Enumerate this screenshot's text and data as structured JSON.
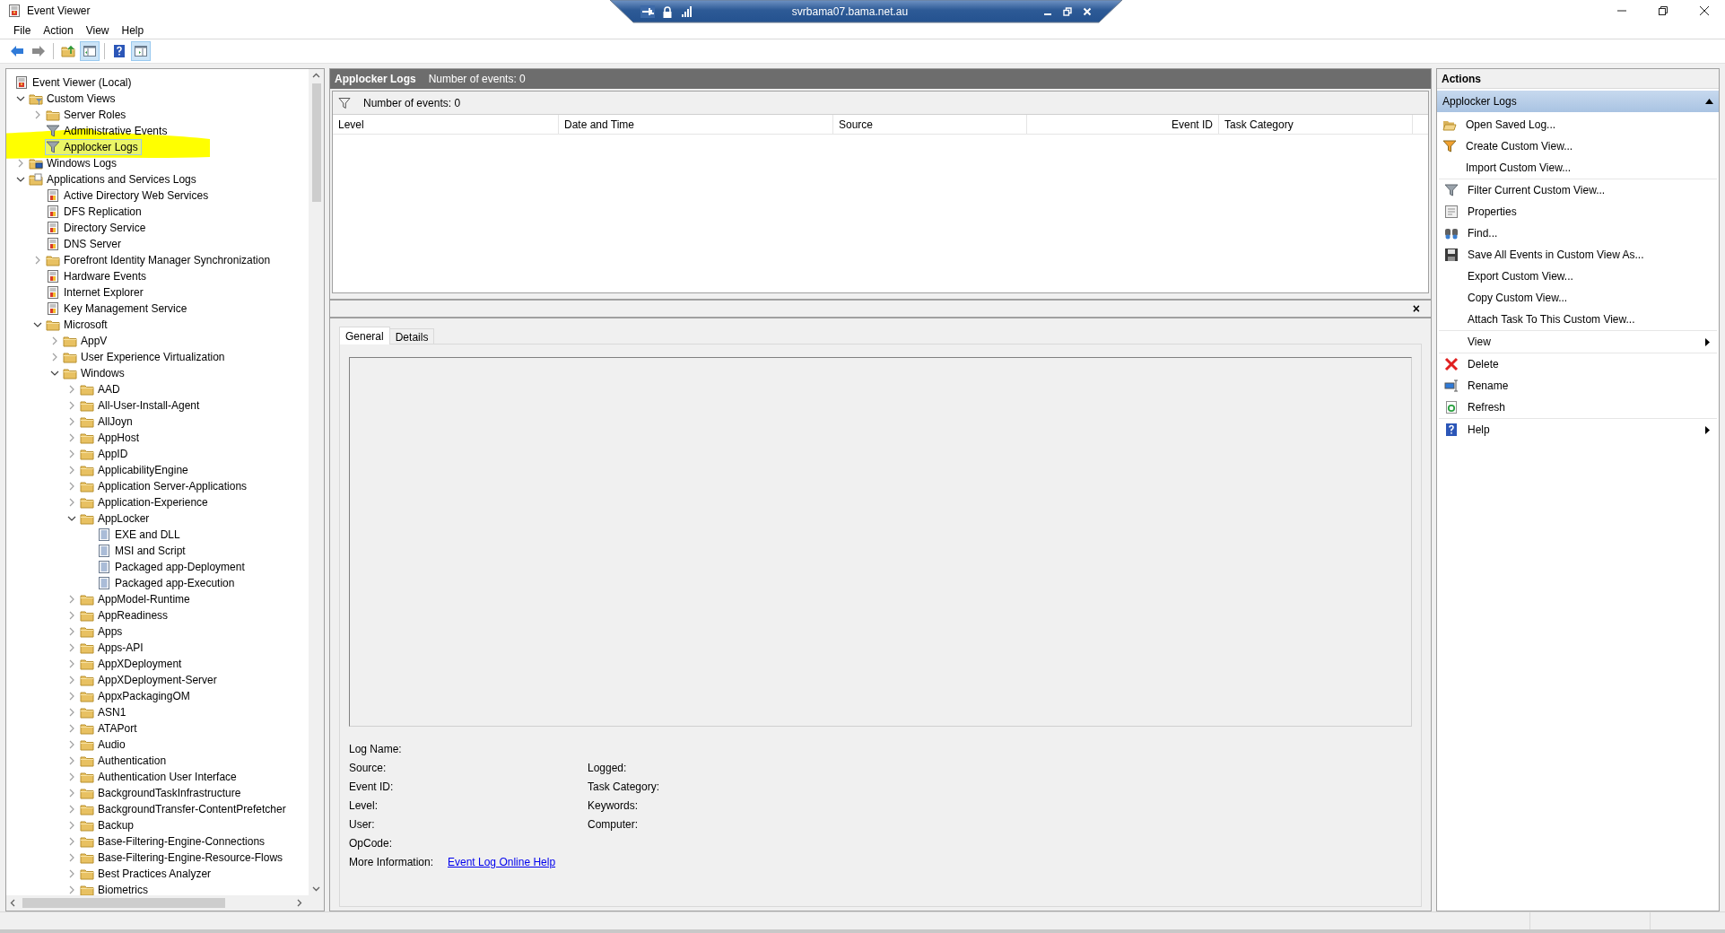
{
  "window": {
    "title": "Event Viewer"
  },
  "remote_bar": {
    "host": "svrbama07.bama.net.au"
  },
  "menu": [
    "File",
    "Action",
    "View",
    "Help"
  ],
  "toolbar": [
    {
      "kind": "back",
      "pressed": false,
      "disabled": false
    },
    {
      "kind": "forward",
      "pressed": false,
      "disabled": true
    },
    {
      "kind": "up",
      "pressed": false,
      "disabled": false
    },
    {
      "kind": "console-tree",
      "pressed": true,
      "disabled": false
    },
    {
      "kind": "help",
      "pressed": false,
      "disabled": false
    },
    {
      "kind": "action-pane",
      "pressed": true,
      "disabled": false
    }
  ],
  "tree": [
    {
      "label": "Event Viewer (Local)",
      "kind": "viewer",
      "selected": false,
      "highlighted": false,
      "children": [
        {
          "label": "Custom Views",
          "kind": "custom-folder",
          "expanded": true,
          "selected": false,
          "highlighted": false,
          "children": [
            {
              "label": "Server Roles",
              "kind": "folder",
              "expanded": false,
              "selected": false,
              "highlighted": false
            },
            {
              "label": "Administrative Events",
              "kind": "filter",
              "selected": false,
              "highlighted": false
            },
            {
              "label": "Applocker Logs",
              "kind": "filter",
              "selected": true,
              "highlighted": true
            }
          ]
        },
        {
          "label": "Windows Logs",
          "kind": "windows-folder",
          "expanded": false,
          "selected": false,
          "highlighted": false
        },
        {
          "label": "Applications and Services Logs",
          "kind": "apps-folder",
          "expanded": true,
          "selected": false,
          "highlighted": false,
          "children": [
            {
              "label": "Active Directory Web Services",
              "kind": "event-log",
              "selected": false,
              "highlighted": false
            },
            {
              "label": "DFS Replication",
              "kind": "event-log",
              "selected": false,
              "highlighted": false
            },
            {
              "label": "Directory Service",
              "kind": "event-log",
              "selected": false,
              "highlighted": false
            },
            {
              "label": "DNS Server",
              "kind": "event-log",
              "selected": false,
              "highlighted": false
            },
            {
              "label": "Forefront Identity Manager Synchronization",
              "kind": "folder",
              "expanded": false,
              "selected": false,
              "highlighted": false
            },
            {
              "label": "Hardware Events",
              "kind": "event-log",
              "selected": false,
              "highlighted": false
            },
            {
              "label": "Internet Explorer",
              "kind": "event-log",
              "selected": false,
              "highlighted": false
            },
            {
              "label": "Key Management Service",
              "kind": "event-log",
              "selected": false,
              "highlighted": false
            },
            {
              "label": "Microsoft",
              "kind": "folder",
              "expanded": true,
              "selected": false,
              "highlighted": false,
              "children": [
                {
                  "label": "AppV",
                  "kind": "folder",
                  "expanded": false,
                  "selected": false,
                  "highlighted": false
                },
                {
                  "label": "User Experience Virtualization",
                  "kind": "folder",
                  "expanded": false,
                  "selected": false,
                  "highlighted": false
                },
                {
                  "label": "Windows",
                  "kind": "folder",
                  "expanded": true,
                  "selected": false,
                  "highlighted": false,
                  "children": [
                    {
                      "label": "AAD",
                      "kind": "folder",
                      "expanded": false,
                      "selected": false,
                      "highlighted": false
                    },
                    {
                      "label": "All-User-Install-Agent",
                      "kind": "folder",
                      "expanded": false,
                      "selected": false,
                      "highlighted": false
                    },
                    {
                      "label": "AllJoyn",
                      "kind": "folder",
                      "expanded": false,
                      "selected": false,
                      "highlighted": false
                    },
                    {
                      "label": "AppHost",
                      "kind": "folder",
                      "expanded": false,
                      "selected": false,
                      "highlighted": false
                    },
                    {
                      "label": "AppID",
                      "kind": "folder",
                      "expanded": false,
                      "selected": false,
                      "highlighted": false
                    },
                    {
                      "label": "ApplicabilityEngine",
                      "kind": "folder",
                      "expanded": false,
                      "selected": false,
                      "highlighted": false
                    },
                    {
                      "label": "Application Server-Applications",
                      "kind": "folder",
                      "expanded": false,
                      "selected": false,
                      "highlighted": false
                    },
                    {
                      "label": "Application-Experience",
                      "kind": "folder",
                      "expanded": false,
                      "selected": false,
                      "highlighted": false
                    },
                    {
                      "label": "AppLocker",
                      "kind": "folder",
                      "expanded": true,
                      "selected": false,
                      "highlighted": false,
                      "children": [
                        {
                          "label": "EXE and DLL",
                          "kind": "plain-log",
                          "selected": false,
                          "highlighted": false
                        },
                        {
                          "label": "MSI and Script",
                          "kind": "plain-log",
                          "selected": false,
                          "highlighted": false
                        },
                        {
                          "label": "Packaged app-Deployment",
                          "kind": "plain-log",
                          "selected": false,
                          "highlighted": false
                        },
                        {
                          "label": "Packaged app-Execution",
                          "kind": "plain-log",
                          "selected": false,
                          "highlighted": false
                        }
                      ]
                    },
                    {
                      "label": "AppModel-Runtime",
                      "kind": "folder",
                      "expanded": false,
                      "selected": false,
                      "highlighted": false
                    },
                    {
                      "label": "AppReadiness",
                      "kind": "folder",
                      "expanded": false,
                      "selected": false,
                      "highlighted": false
                    },
                    {
                      "label": "Apps",
                      "kind": "folder",
                      "expanded": false,
                      "selected": false,
                      "highlighted": false
                    },
                    {
                      "label": "Apps-API",
                      "kind": "folder",
                      "expanded": false,
                      "selected": false,
                      "highlighted": false
                    },
                    {
                      "label": "AppXDeployment",
                      "kind": "folder",
                      "expanded": false,
                      "selected": false,
                      "highlighted": false
                    },
                    {
                      "label": "AppXDeployment-Server",
                      "kind": "folder",
                      "expanded": false,
                      "selected": false,
                      "highlighted": false
                    },
                    {
                      "label": "AppxPackagingOM",
                      "kind": "folder",
                      "expanded": false,
                      "selected": false,
                      "highlighted": false
                    },
                    {
                      "label": "ASN1",
                      "kind": "folder",
                      "expanded": false,
                      "selected": false,
                      "highlighted": false
                    },
                    {
                      "label": "ATAPort",
                      "kind": "folder",
                      "expanded": false,
                      "selected": false,
                      "highlighted": false
                    },
                    {
                      "label": "Audio",
                      "kind": "folder",
                      "expanded": false,
                      "selected": false,
                      "highlighted": false
                    },
                    {
                      "label": "Authentication",
                      "kind": "folder",
                      "expanded": false,
                      "selected": false,
                      "highlighted": false
                    },
                    {
                      "label": "Authentication User Interface",
                      "kind": "folder",
                      "expanded": false,
                      "selected": false,
                      "highlighted": false
                    },
                    {
                      "label": "BackgroundTaskInfrastructure",
                      "kind": "folder",
                      "expanded": false,
                      "selected": false,
                      "highlighted": false
                    },
                    {
                      "label": "BackgroundTransfer-ContentPrefetcher",
                      "kind": "folder",
                      "expanded": false,
                      "selected": false,
                      "highlighted": false
                    },
                    {
                      "label": "Backup",
                      "kind": "folder",
                      "expanded": false,
                      "selected": false,
                      "highlighted": false
                    },
                    {
                      "label": "Base-Filtering-Engine-Connections",
                      "kind": "folder",
                      "expanded": false,
                      "selected": false,
                      "highlighted": false
                    },
                    {
                      "label": "Base-Filtering-Engine-Resource-Flows",
                      "kind": "folder",
                      "expanded": false,
                      "selected": false,
                      "highlighted": false
                    },
                    {
                      "label": "Best Practices Analyzer",
                      "kind": "folder",
                      "expanded": false,
                      "selected": false,
                      "highlighted": false
                    },
                    {
                      "label": "Biometrics",
                      "kind": "folder",
                      "expanded": false,
                      "selected": false,
                      "highlighted": false
                    }
                  ]
                }
              ]
            }
          ]
        }
      ]
    }
  ],
  "events": {
    "title": "Applocker Logs",
    "count": "Number of events: 0",
    "filter_text": "Number of events: 0",
    "columns": [
      "Level",
      "Date and Time",
      "Source",
      "Event ID",
      "Task Category"
    ]
  },
  "preview": {
    "close": "×",
    "tabs": [
      {
        "label": "General",
        "selected": true
      },
      {
        "label": "Details",
        "selected": false
      }
    ],
    "rows": [
      [
        "Log Name:"
      ],
      [
        "Source:",
        "Logged:"
      ],
      [
        "Event ID:",
        "Task Category:"
      ],
      [
        "Level:",
        "Keywords:"
      ],
      [
        "User:",
        "Computer:"
      ],
      [
        "OpCode:"
      ]
    ],
    "more_info": {
      "label": "More Information:",
      "link": "Event Log Online Help"
    }
  },
  "actions": {
    "title": "Actions",
    "section": {
      "title": "Applocker Logs",
      "expanded": true
    },
    "groups": [
      [
        {
          "label": "Open Saved Log...",
          "kind": "open",
          "submenu": false
        },
        {
          "label": "Create Custom View...",
          "kind": "create-filter",
          "submenu": false
        },
        {
          "label": "Import Custom View...",
          "kind": "plain",
          "submenu": false
        }
      ],
      [
        {
          "label": "Filter Current Custom View...",
          "kind": "filter",
          "submenu": false
        },
        {
          "label": "Properties",
          "kind": "properties",
          "submenu": false
        },
        {
          "label": "Find...",
          "kind": "find",
          "submenu": false
        },
        {
          "label": "Save All Events in Custom View As...",
          "kind": "save",
          "submenu": false
        },
        {
          "label": "Export Custom View...",
          "kind": "plain",
          "submenu": false
        },
        {
          "label": "Copy Custom View...",
          "kind": "plain",
          "submenu": false
        },
        {
          "label": "Attach Task To This Custom View...",
          "kind": "plain",
          "submenu": false
        }
      ],
      [
        {
          "label": "View",
          "kind": "plain",
          "submenu": true
        }
      ],
      [
        {
          "label": "Delete",
          "kind": "delete",
          "submenu": false
        },
        {
          "label": "Rename",
          "kind": "rename",
          "submenu": false
        },
        {
          "label": "Refresh",
          "kind": "refresh",
          "submenu": false
        }
      ],
      [
        {
          "label": "Help",
          "kind": "help",
          "submenu": true
        }
      ]
    ]
  }
}
